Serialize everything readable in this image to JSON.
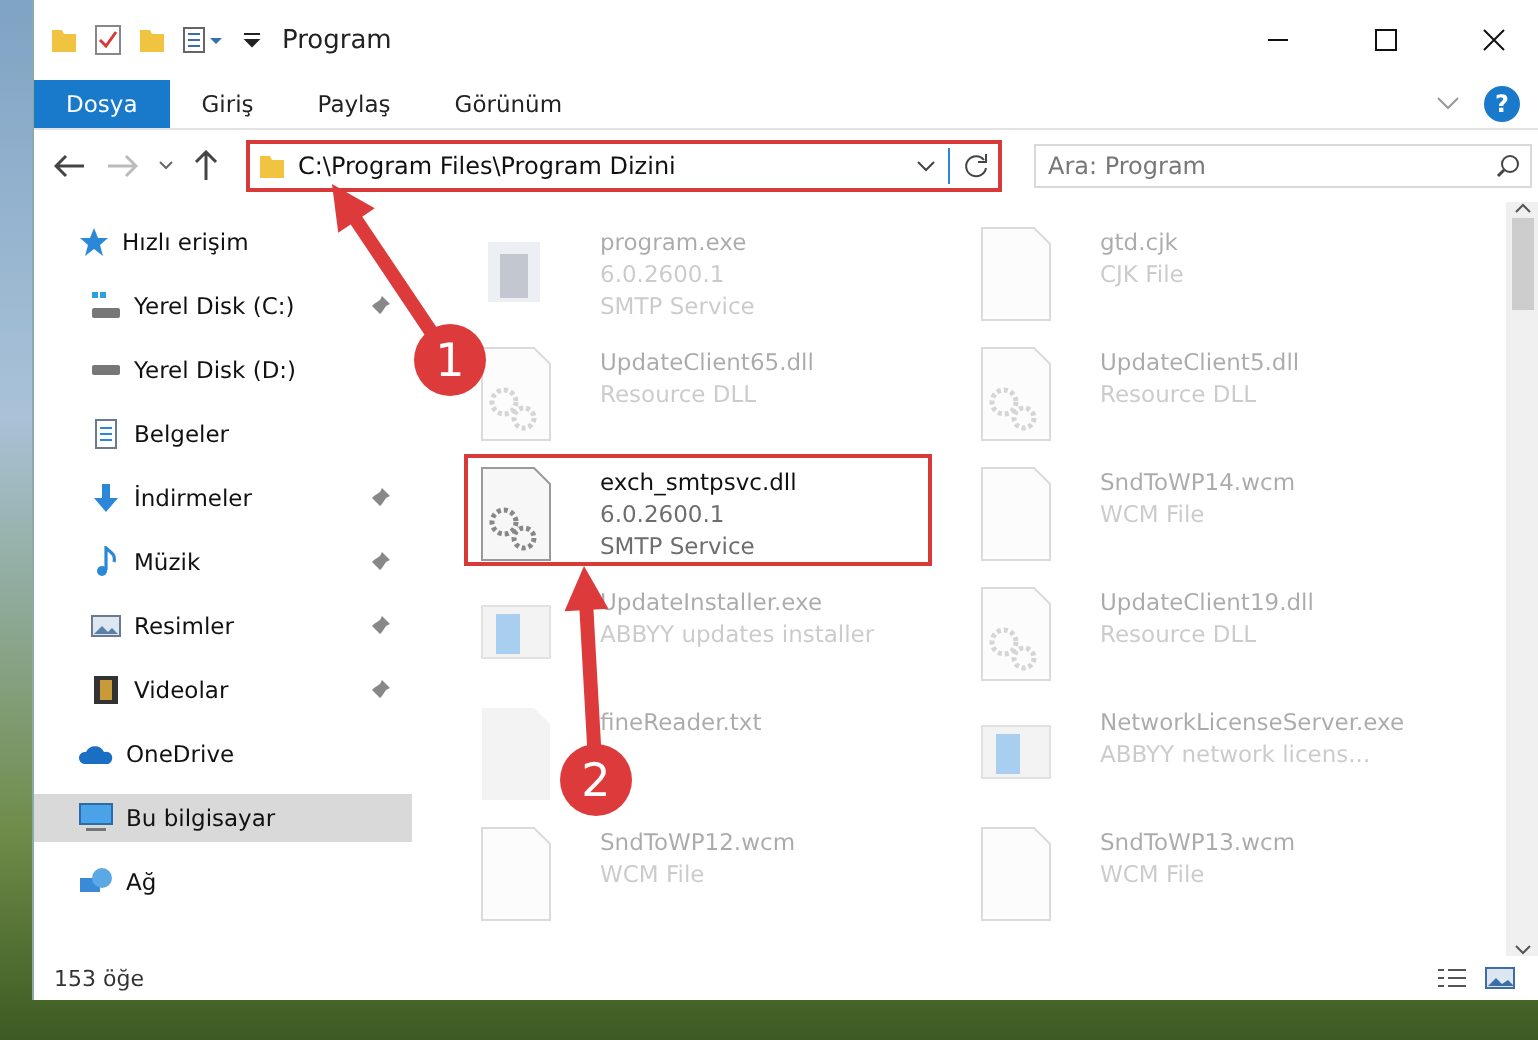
{
  "window": {
    "title": "Program",
    "help": "?"
  },
  "ribbon_tabs": [
    {
      "label": "Dosya",
      "selected": true
    },
    {
      "label": "Giriş",
      "selected": false
    },
    {
      "label": "Paylaş",
      "selected": false
    },
    {
      "label": "Görünüm",
      "selected": false
    }
  ],
  "address": {
    "path": "C:\\Program Files\\Program Dizini",
    "highlighted": true
  },
  "search": {
    "placeholder": "Ara: Program"
  },
  "sidebar": {
    "items": [
      {
        "label": "Hızlı erişim",
        "kind": "star",
        "pinned": false,
        "selected": false,
        "children": [
          {
            "label": "Yerel Disk (C:)",
            "kind": "drive-c",
            "pinned": true,
            "selected": false
          },
          {
            "label": "Yerel Disk (D:)",
            "kind": "drive",
            "pinned": false,
            "selected": false
          },
          {
            "label": "Belgeler",
            "kind": "doc",
            "pinned": false,
            "selected": false
          },
          {
            "label": "İndirmeler",
            "kind": "download",
            "pinned": true,
            "selected": false
          },
          {
            "label": "Müzik",
            "kind": "music",
            "pinned": true,
            "selected": false
          },
          {
            "label": "Resimler",
            "kind": "picture",
            "pinned": true,
            "selected": false
          },
          {
            "label": "Videolar",
            "kind": "video",
            "pinned": true,
            "selected": false
          }
        ]
      },
      {
        "label": "OneDrive",
        "kind": "cloud",
        "pinned": false,
        "selected": false
      },
      {
        "label": "Bu bilgisayar",
        "kind": "pc",
        "pinned": false,
        "selected": true
      },
      {
        "label": "Ağ",
        "kind": "network",
        "pinned": false,
        "selected": false
      }
    ]
  },
  "files": [
    {
      "name": "program.exe",
      "lines": [
        "6.0.2600.1",
        "SMTP Service"
      ],
      "kind": "app",
      "faded": true,
      "highlighted": false
    },
    {
      "name": "gtd.cjk",
      "lines": [
        "CJK File"
      ],
      "kind": "blank",
      "faded": true,
      "highlighted": false
    },
    {
      "name": "UpdateClient65.dll",
      "lines": [
        "Resource DLL"
      ],
      "kind": "gears",
      "faded": true,
      "highlighted": false
    },
    {
      "name": "UpdateClient5.dll",
      "lines": [
        "Resource DLL"
      ],
      "kind": "gears",
      "faded": true,
      "highlighted": false
    },
    {
      "name": "exch_smtpsvc.dll",
      "lines": [
        "6.0.2600.1",
        "SMTP Service"
      ],
      "kind": "gears",
      "faded": false,
      "highlighted": true
    },
    {
      "name": "SndToWP14.wcm",
      "lines": [
        "WCM File"
      ],
      "kind": "blank",
      "faded": true,
      "highlighted": false
    },
    {
      "name": "UpdateInstaller.exe",
      "lines": [
        "ABBYY updates installer"
      ],
      "kind": "window",
      "faded": true,
      "highlighted": false
    },
    {
      "name": "UpdateClient19.dll",
      "lines": [
        "Resource DLL"
      ],
      "kind": "gears",
      "faded": true,
      "highlighted": false
    },
    {
      "name": "fineReader.txt",
      "kind": "text",
      "faded": true,
      "highlighted": false
    },
    {
      "name": "NetworkLicenseServer.exe",
      "lines": [
        "ABBYY network licens..."
      ],
      "kind": "window",
      "faded": true,
      "highlighted": false
    },
    {
      "name": "SndToWP12.wcm",
      "lines": [
        "WCM File"
      ],
      "kind": "blank",
      "faded": true,
      "highlighted": false
    },
    {
      "name": "SndToWP13.wcm",
      "lines": [
        "WCM File"
      ],
      "kind": "blank",
      "faded": true,
      "highlighted": false
    }
  ],
  "status_bar": {
    "count": "153 öğe"
  },
  "annotations": [
    {
      "number": "1"
    },
    {
      "number": "2"
    }
  ]
}
